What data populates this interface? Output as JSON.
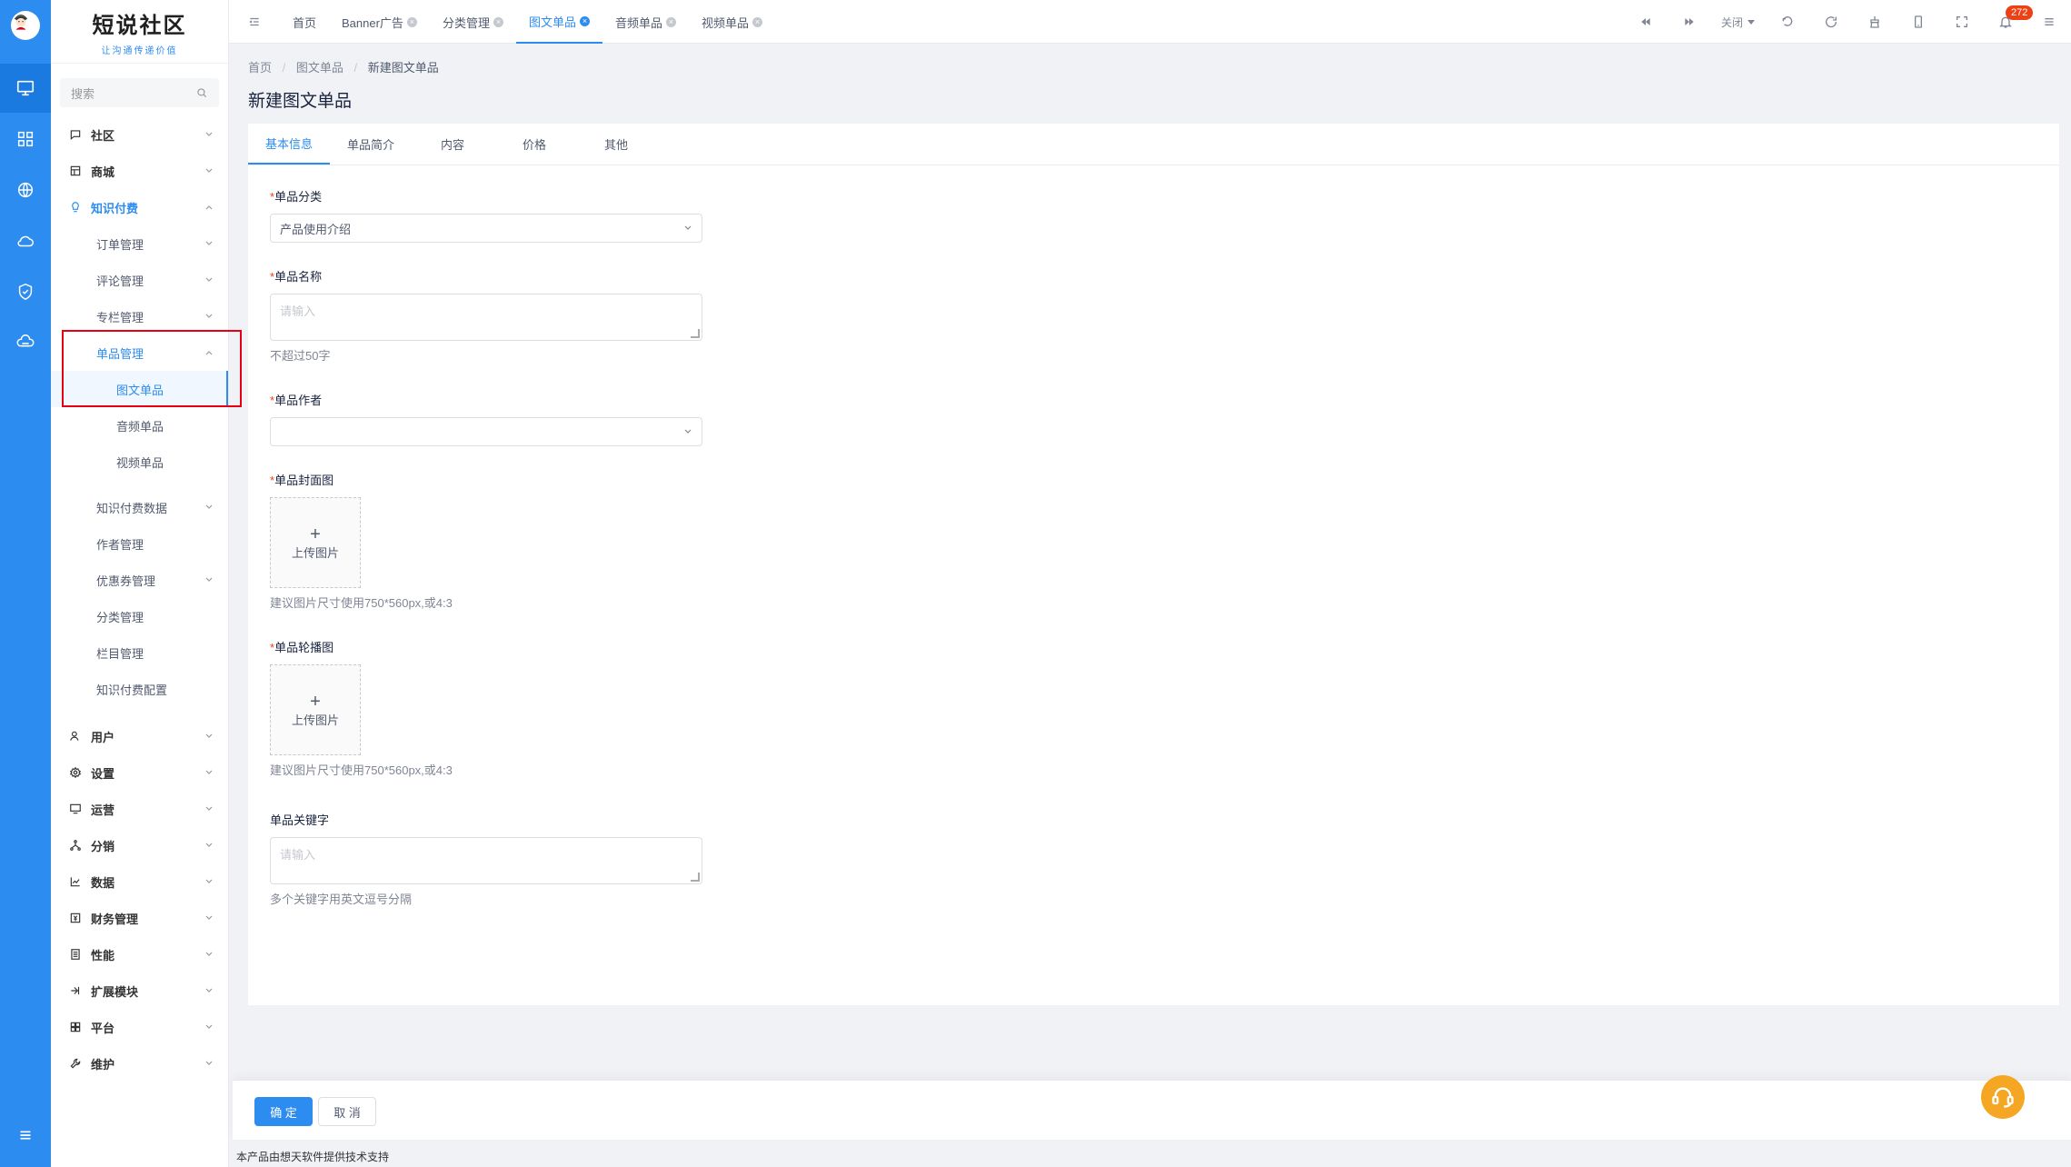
{
  "brand": {
    "title": "短说社区",
    "slogan": "让沟通传递价值"
  },
  "search": {
    "placeholder": "搜索"
  },
  "sidebar": {
    "items": [
      {
        "label": "社区",
        "icon": "chat-icon"
      },
      {
        "label": "商城",
        "icon": "shop-icon"
      },
      {
        "label": "知识付费",
        "icon": "bulb-icon"
      },
      {
        "label": "订单管理"
      },
      {
        "label": "评论管理"
      },
      {
        "label": "专栏管理"
      },
      {
        "label": "单品管理"
      },
      {
        "label": "图文单品"
      },
      {
        "label": "音频单品"
      },
      {
        "label": "视频单品"
      },
      {
        "label": "知识付费数据"
      },
      {
        "label": "作者管理"
      },
      {
        "label": "优惠券管理"
      },
      {
        "label": "分类管理"
      },
      {
        "label": "栏目管理"
      },
      {
        "label": "知识付费配置"
      },
      {
        "label": "用户",
        "icon": "user-icon"
      },
      {
        "label": "设置",
        "icon": "gear-icon"
      },
      {
        "label": "运营",
        "icon": "monitor-icon"
      },
      {
        "label": "分销",
        "icon": "share-icon"
      },
      {
        "label": "数据",
        "icon": "chart-icon"
      },
      {
        "label": "财务管理",
        "icon": "finance-icon"
      },
      {
        "label": "性能",
        "icon": "performance-icon"
      },
      {
        "label": "扩展模块",
        "icon": "extension-icon"
      },
      {
        "label": "平台",
        "icon": "platform-icon"
      },
      {
        "label": "维护",
        "icon": "wrench-icon"
      }
    ]
  },
  "tabs": [
    {
      "label": "首页"
    },
    {
      "label": "Banner广告"
    },
    {
      "label": "分类管理"
    },
    {
      "label": "图文单品"
    },
    {
      "label": "音频单品"
    },
    {
      "label": "视频单品"
    }
  ],
  "toolbar": {
    "close_label": "关闭",
    "badge_count": "272"
  },
  "breadcrumb": {
    "home": "首页",
    "parent": "图文单品",
    "current": "新建图文单品"
  },
  "page": {
    "title": "新建图文单品"
  },
  "form_tabs": [
    "基本信息",
    "单品简介",
    "内容",
    "价格",
    "其他"
  ],
  "form": {
    "category": {
      "label": "单品分类",
      "value": "产品使用介绍"
    },
    "name": {
      "label": "单品名称",
      "placeholder": "请输入",
      "hint": "不超过50字"
    },
    "author": {
      "label": "单品作者",
      "value": ""
    },
    "cover": {
      "label": "单品封面图",
      "upload_label": "上传图片",
      "hint": "建议图片尺寸使用750*560px,或4:3"
    },
    "carousel": {
      "label": "单品轮播图",
      "upload_label": "上传图片",
      "hint": "建议图片尺寸使用750*560px,或4:3"
    },
    "keywords": {
      "label": "单品关键字",
      "placeholder": "请输入",
      "hint": "多个关键字用英文逗号分隔"
    }
  },
  "actions": {
    "confirm": "确 定",
    "cancel": "取 消"
  },
  "footer": {
    "copyright": "本产品由想天软件提供技术支持"
  },
  "colors": {
    "primary": "#2d8cf0",
    "danger": "#ed4014",
    "support": "#f5a623"
  }
}
